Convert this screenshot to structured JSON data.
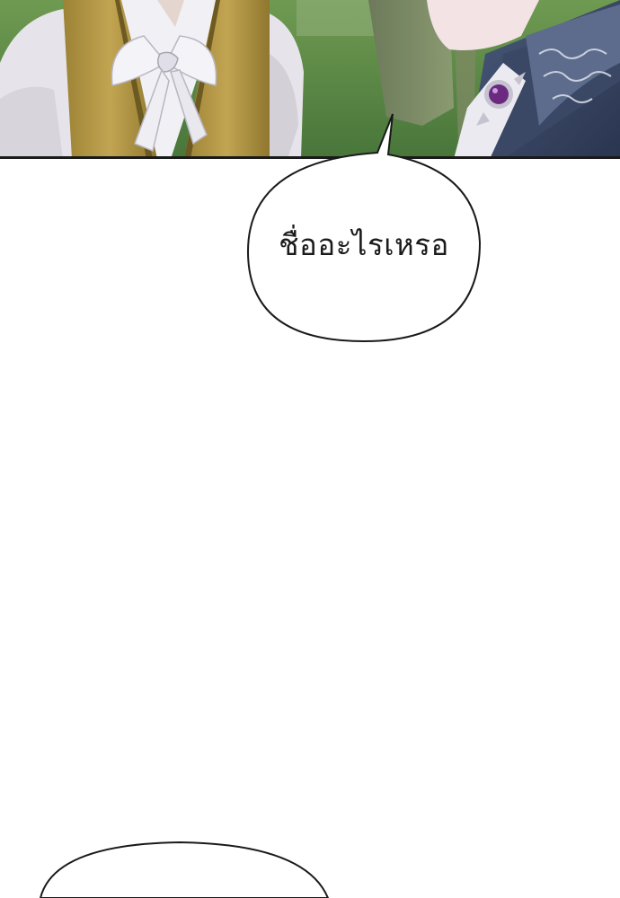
{
  "speech_bubbles": [
    {
      "text": "ชื่ออะไรเหรอ"
    },
    {
      "text": ""
    }
  ],
  "colors": {
    "panel_border": "#1a1a1a",
    "bubble_fill": "#ffffff",
    "bubble_stroke": "#1a1a1a",
    "grass": "#5e8a3e",
    "vest": "#b89a45",
    "shirt": "#ecebf0",
    "coat": "#3b4a66",
    "brooch": "#6b2a80"
  }
}
